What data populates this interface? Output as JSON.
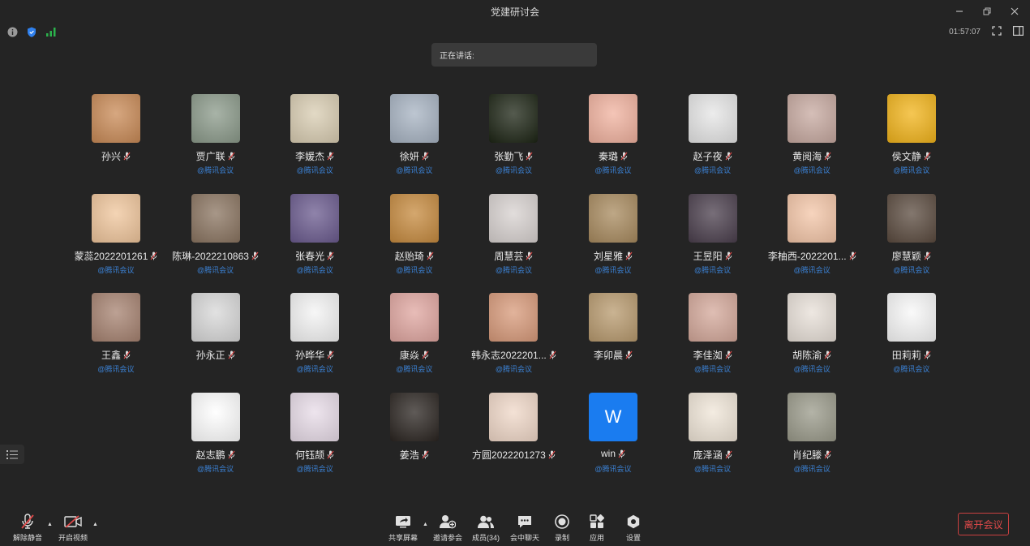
{
  "window": {
    "title": "党建研讨会"
  },
  "timer": "01:57:07",
  "speaking_label": "正在讲话:",
  "org_label": "@腾讯会议",
  "participants": [
    {
      "name": "孙兴",
      "org": "",
      "bg": "#c98a56"
    },
    {
      "name": "贾广联",
      "org": "@腾讯会议",
      "bg": "#8b9a8a"
    },
    {
      "name": "李媛杰",
      "org": "@腾讯会议",
      "bg": "#d9cdb2"
    },
    {
      "name": "徐妍",
      "org": "@腾讯会议",
      "bg": "#a7b3c2"
    },
    {
      "name": "张勤飞",
      "org": "@腾讯会议",
      "bg": "#1c2414"
    },
    {
      "name": "秦璐",
      "org": "@腾讯会议",
      "bg": "#f1b29f"
    },
    {
      "name": "赵子夜",
      "org": "@腾讯会议",
      "bg": "#e6e6e6"
    },
    {
      "name": "黄阅海",
      "org": "@腾讯会议",
      "bg": "#c7a9a0"
    },
    {
      "name": "侯文静",
      "org": "@腾讯会议",
      "bg": "#f2b41a"
    },
    {
      "name": "蒙蕊2022201261",
      "org": "@腾讯会议",
      "bg": "#f0c69c"
    },
    {
      "name": "陈琳-2022210863",
      "org": "@腾讯会议",
      "bg": "#8a7460"
    },
    {
      "name": "张春光",
      "org": "@腾讯会议",
      "bg": "#6a5a8e"
    },
    {
      "name": "赵贻琦",
      "org": "@腾讯会议",
      "bg": "#c68a3e"
    },
    {
      "name": "周慧芸",
      "org": "@腾讯会议",
      "bg": "#d8d2d0"
    },
    {
      "name": "刘星雅",
      "org": "@腾讯会议",
      "bg": "#a88a5e"
    },
    {
      "name": "王昱阳",
      "org": "@腾讯会议",
      "bg": "#4a3e4c"
    },
    {
      "name": "李柚西-2022201...",
      "org": "@腾讯会议",
      "bg": "#f4c6a8"
    },
    {
      "name": "廖慧颖",
      "org": "@腾讯会议",
      "bg": "#5a4a3e"
    },
    {
      "name": "王鑫",
      "org": "@腾讯会议",
      "bg": "#a68270"
    },
    {
      "name": "孙永正",
      "org": "",
      "bg": "#d8d8d8"
    },
    {
      "name": "孙晔华",
      "org": "@腾讯会议",
      "bg": "#f4f4f4"
    },
    {
      "name": "康焱",
      "org": "@腾讯会议",
      "bg": "#e0a6a0"
    },
    {
      "name": "韩永志2022201...",
      "org": "@腾讯会议",
      "bg": "#d89a7a"
    },
    {
      "name": "李卯晨",
      "org": "",
      "bg": "#b89a6e"
    },
    {
      "name": "李佳洳",
      "org": "@腾讯会议",
      "bg": "#d4a89a"
    },
    {
      "name": "胡陈渝",
      "org": "@腾讯会议",
      "bg": "#e8e0d8"
    },
    {
      "name": "田莉莉",
      "org": "@腾讯会议",
      "bg": "#f8f8f8"
    },
    {
      "name": "赵志鹏",
      "org": "@腾讯会议",
      "bg": "#ffffff"
    },
    {
      "name": "何钰颉",
      "org": "@腾讯会议",
      "bg": "#e8dce8"
    },
    {
      "name": "姜浩",
      "org": "",
      "bg": "#2a2420"
    },
    {
      "name": "方圆2022201273",
      "org": "",
      "bg": "#f0d8c8"
    },
    {
      "name": "win",
      "org": "@腾讯会议",
      "bg": "#1a7cf0",
      "initial": "W"
    },
    {
      "name": "庞泽涵",
      "org": "@腾讯会议",
      "bg": "#f0e6d8"
    },
    {
      "name": "肖纪滕",
      "org": "@腾讯会议",
      "bg": "#9a9a8a"
    }
  ],
  "toolbar": {
    "unmute": "解除静音",
    "start_video": "开启视频",
    "share": "共享屏幕",
    "invite": "邀请参会",
    "members": "成员(34)",
    "chat": "会中聊天",
    "record": "录制",
    "apps": "应用",
    "settings": "设置",
    "leave": "离开会议"
  }
}
